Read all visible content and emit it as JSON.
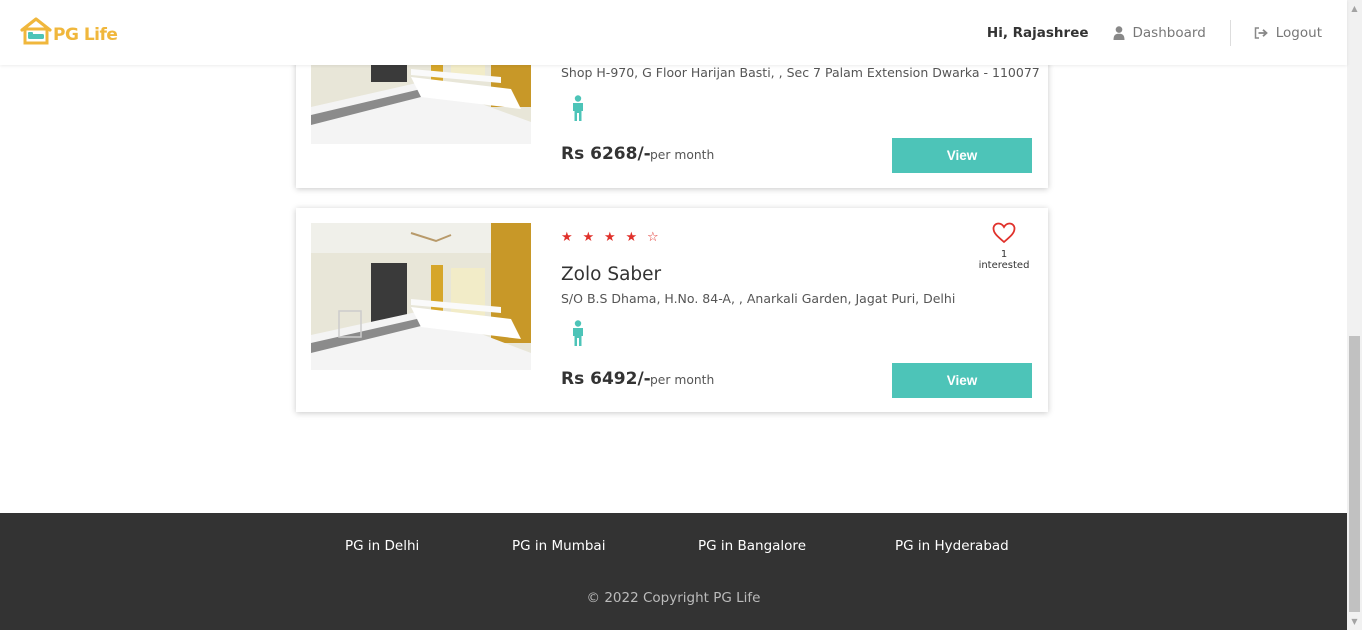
{
  "header": {
    "logo_text": "PG Life",
    "greeting": "Hi, Rajashree",
    "dashboard_label": "Dashboard",
    "logout_label": "Logout"
  },
  "colors": {
    "accent": "#4dc4b8",
    "star": "#e0312b",
    "footer": "#333333",
    "logo": "#f0b73c"
  },
  "properties": [
    {
      "name": "",
      "address": "Shop H-970, G Floor Harijan Basti, , Sec 7 Palam Extension Dwarka - 110077",
      "gender_icon": "male-icon",
      "price": "Rs 6268/-",
      "per_month": "per month",
      "view_label": "View"
    },
    {
      "stars": [
        "★",
        "★",
        "★",
        "★",
        "☆"
      ],
      "rating": 4,
      "favorite_icon": "heart-outline-icon",
      "interested": "1 interested",
      "name": "Zolo Saber",
      "address": "S/O B.S Dhama, H.No. 84-A, , Anarkali Garden, Jagat Puri, Delhi",
      "gender_icon": "male-icon",
      "price": "Rs 6492/-",
      "per_month": "per month",
      "view_label": "View"
    }
  ],
  "footer": {
    "links": [
      "PG in Delhi",
      "PG in Mumbai",
      "PG in Bangalore",
      "PG in Hyderabad"
    ],
    "copyright": "© 2022 Copyright PG Life"
  }
}
